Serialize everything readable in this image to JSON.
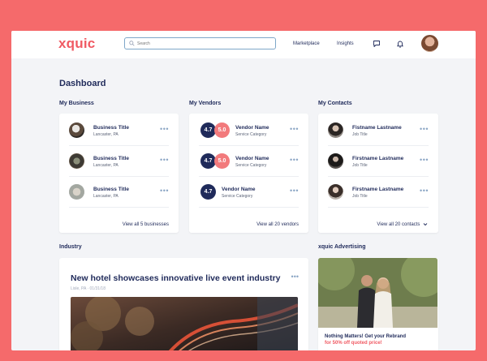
{
  "app": {
    "logo": "xquic"
  },
  "header": {
    "search_placeholder": "Search",
    "nav": {
      "marketplace": "Marketplace",
      "insights": "Insights"
    }
  },
  "page": {
    "title": "Dashboard"
  },
  "sections": {
    "my_business": "My Business",
    "my_vendors": "My Vendors",
    "my_contacts": "My Contacts",
    "industry": "Industry",
    "advertising": "xquic Advertising"
  },
  "business": {
    "items": [
      {
        "title": "Business Title",
        "location": "Lancaster, PA"
      },
      {
        "title": "Business Title",
        "location": "Lancaster, PA"
      },
      {
        "title": "Business Title",
        "location": "Lancaster, PA"
      }
    ],
    "view_all": "View all 5 businesses"
  },
  "vendors": {
    "items": [
      {
        "name": "Vendor Name",
        "category": "Service Category",
        "score1": "4.7",
        "score2": "5.0"
      },
      {
        "name": "Vendor Name",
        "category": "Service Category",
        "score1": "4.7",
        "score2": "5.0"
      },
      {
        "name": "Vendor Name",
        "category": "Service Category",
        "score1": "4.7"
      }
    ],
    "view_all": "View all 20 vendors"
  },
  "contacts": {
    "items": [
      {
        "name": "Fistname Lastname",
        "job": "Job Title"
      },
      {
        "name": "Firstname Lastname",
        "job": "Job Title"
      },
      {
        "name": "Firstname Lastname",
        "job": "Job Title"
      }
    ],
    "view_all": "View all 20 contacts"
  },
  "industry_news": {
    "headline": "New hotel showcases innovative live event industry",
    "meta": "Lisle, PA · 01/31/18"
  },
  "ad": {
    "line1_a": "Nothing Matters! Get your Rebrand",
    "line1_b": "for 50% off quoted price!"
  },
  "colors": {
    "brand": "#f05a63",
    "navy": "#1f2a5a",
    "background": "#f56a6b"
  }
}
